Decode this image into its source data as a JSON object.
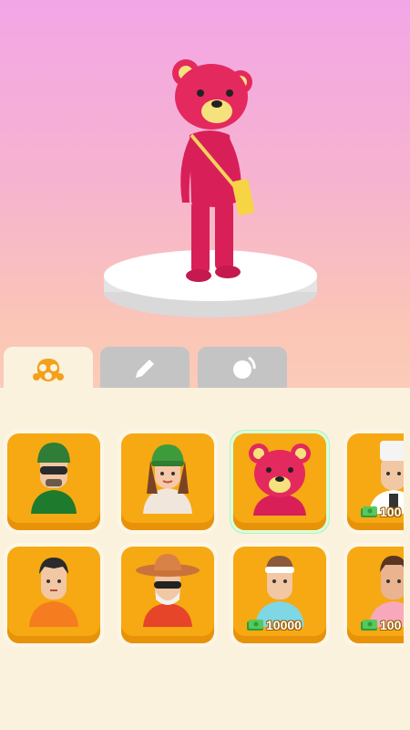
{
  "scene": {
    "character": "pink-bear-costume",
    "pedestal": "white-round-pedestal"
  },
  "tabs": [
    {
      "name": "character",
      "icon": "gas-mask-icon",
      "active": true
    },
    {
      "name": "paint",
      "icon": "pencil-icon",
      "active": false
    },
    {
      "name": "dance",
      "icon": "ball-icon",
      "active": false
    }
  ],
  "skins": [
    {
      "icon": "soldier-avatar-icon",
      "price": ""
    },
    {
      "icon": "green-beanie-girl-avatar-icon",
      "price": ""
    },
    {
      "icon": "pink-bear-avatar-icon",
      "price": "",
      "selected": true
    },
    {
      "icon": "chef-avatar-icon",
      "price": "100"
    },
    {
      "icon": "orange-shirt-boy-avatar-icon",
      "price": ""
    },
    {
      "icon": "old-man-sunglasses-avatar-icon",
      "price": ""
    },
    {
      "icon": "headband-athlete-avatar-icon",
      "price": "10000"
    },
    {
      "icon": "pink-shirt-man-avatar-icon",
      "price": "100"
    }
  ],
  "colors": {
    "card": "#f6a912",
    "card_shadow": "#e8920a",
    "panel": "#fbf2de",
    "selected_glow": "#b8f2c8",
    "tab_active_icon": "#f3a01a",
    "tab_inactive": "#c4c4c4"
  }
}
